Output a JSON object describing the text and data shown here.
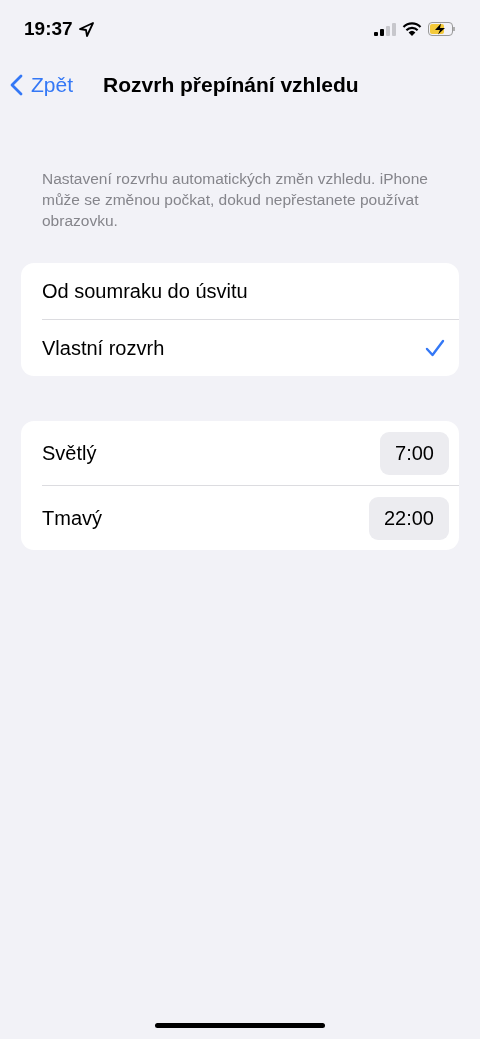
{
  "status_bar": {
    "time": "19:37"
  },
  "nav_bar": {
    "back": "Zpět",
    "title": "Rozvrh přepínání vzhledu"
  },
  "footer": "Nastavení rozvrhu automatických změn vzhledu. iPhone může se změnou počkat, dokud nepřestanete používat obrazovku.",
  "options": [
    {
      "label": "Od soumraku do úsvitu",
      "selected": false
    },
    {
      "label": "Vlastní rozvrh",
      "selected": true
    }
  ],
  "times": [
    {
      "label": "Světlý",
      "value": "7:00"
    },
    {
      "label": "Tmavý",
      "value": "22:00"
    }
  ]
}
